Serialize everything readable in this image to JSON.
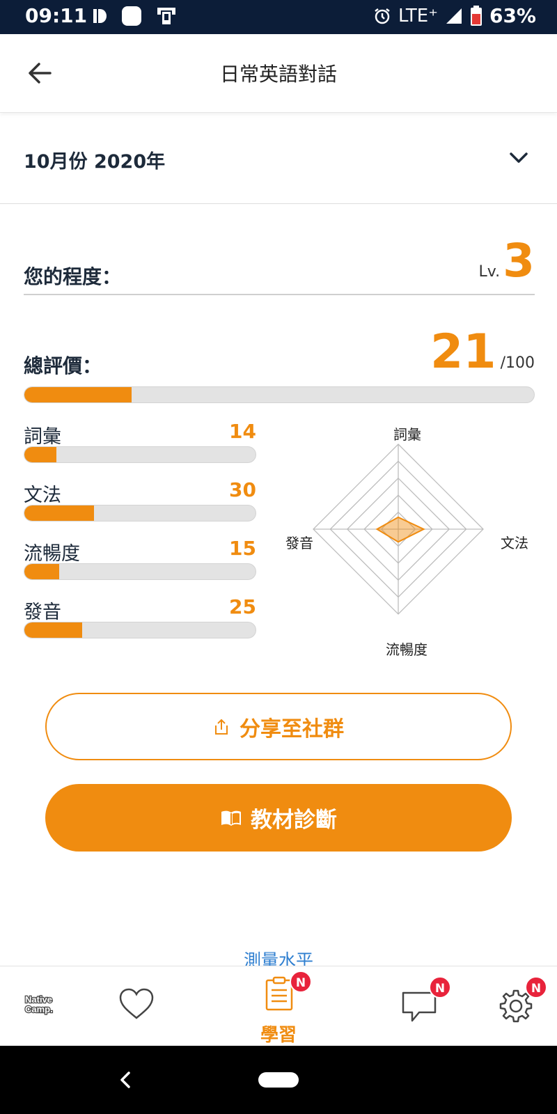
{
  "status_bar": {
    "time": "09:11",
    "network": "LTE⁺",
    "battery": "63%"
  },
  "header": {
    "title": "日常英語對話"
  },
  "month_selector": {
    "value": "10月份 2020年"
  },
  "level": {
    "label": "您的程度：",
    "prefix": "Lv.",
    "value": "3"
  },
  "overall": {
    "label": "總評價：",
    "score": "21",
    "max": "/100",
    "fraction": 0.21
  },
  "skills": [
    {
      "name": "詞彙",
      "score": "14",
      "fraction": 0.14
    },
    {
      "name": "文法",
      "score": "30",
      "fraction": 0.3
    },
    {
      "name": "流暢度",
      "score": "15",
      "fraction": 0.15
    },
    {
      "name": "發音",
      "score": "25",
      "fraction": 0.25
    }
  ],
  "radar": {
    "axes": {
      "top": "詞彙",
      "right": "文法",
      "bottom": "流暢度",
      "left": "發音"
    }
  },
  "buttons": {
    "share": "分享至社群",
    "diagnosis": "教材診斷"
  },
  "measure_link": "測量水平",
  "bottom_nav": {
    "logo_line1": "Native",
    "logo_line2": "Camp.",
    "study_label": "學習",
    "badge": "N"
  },
  "colors": {
    "accent": "#f08c10",
    "status_bar": "#0c1d38",
    "badge": "#e8233b",
    "link": "#2f7fd0"
  },
  "icons": {
    "back": "back-arrow-icon",
    "month": "chevron-down-icon",
    "share": "share-icon",
    "diagnosis": "book-icon",
    "favorites": "heart-icon",
    "study": "clipboard-icon",
    "chat": "chat-bubble-icon",
    "settings": "gear-icon"
  }
}
